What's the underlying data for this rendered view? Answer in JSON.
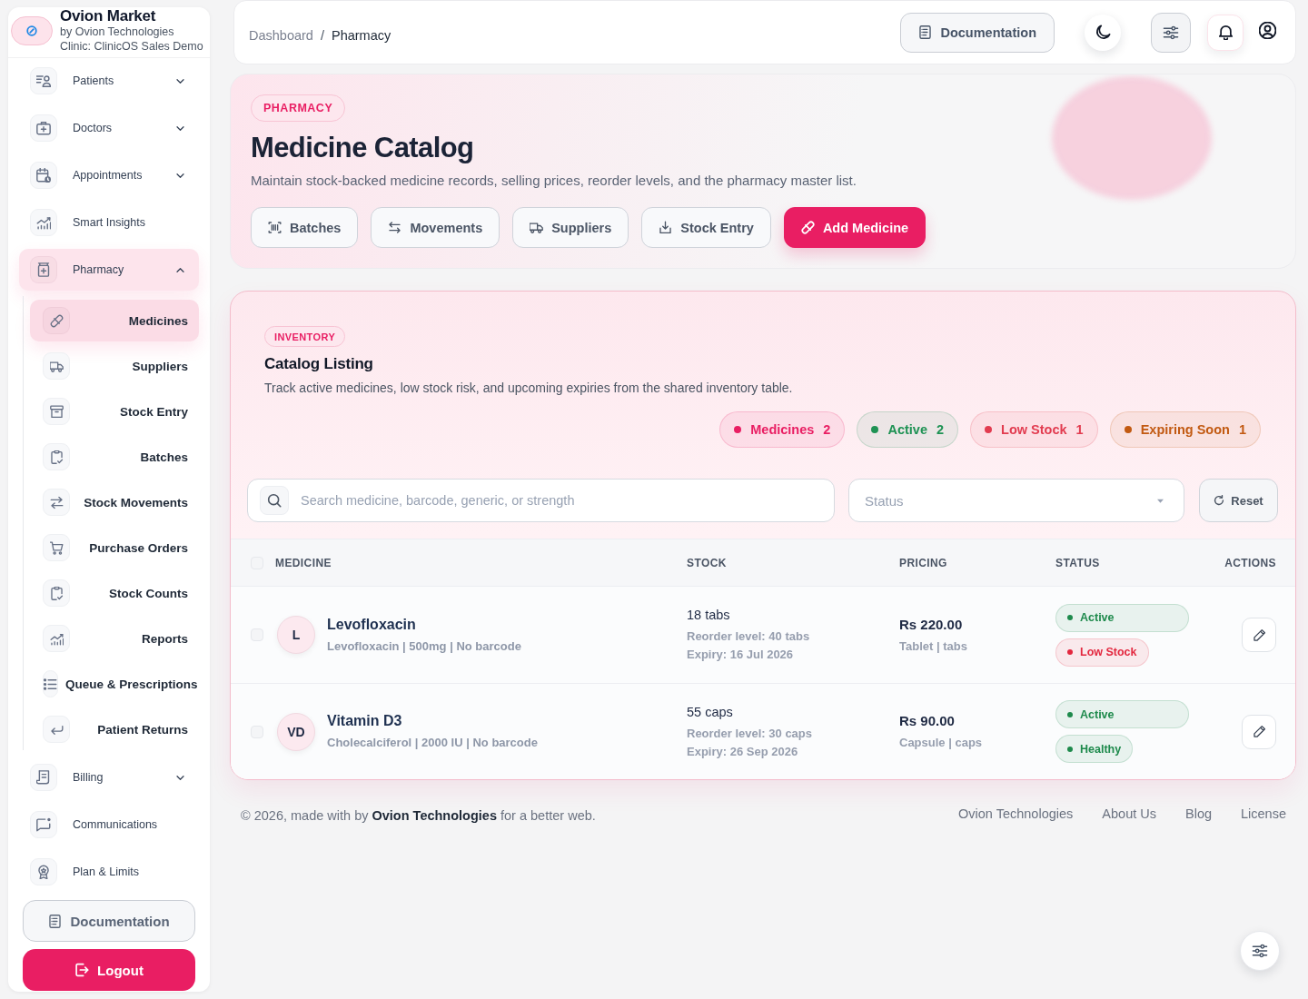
{
  "sidebar": {
    "brand": {
      "name": "Ovion Market",
      "byline": "by Ovion Technologies",
      "clinic": "Clinic: ClinicOS Sales Demo"
    },
    "nav": [
      {
        "label": "Patients",
        "kind": "group",
        "expanded": false,
        "selected": false
      },
      {
        "label": "Doctors",
        "kind": "group",
        "expanded": false,
        "selected": false
      },
      {
        "label": "Appointments",
        "kind": "group",
        "expanded": false,
        "selected": false
      },
      {
        "label": "Smart Insights",
        "kind": "link",
        "selected": false
      },
      {
        "label": "Pharmacy",
        "kind": "group",
        "expanded": true,
        "selected": true,
        "children": [
          {
            "label": "Medicines",
            "selected": true
          },
          {
            "label": "Suppliers",
            "selected": false
          },
          {
            "label": "Stock Entry",
            "selected": false
          },
          {
            "label": "Batches",
            "selected": false
          },
          {
            "label": "Stock Movements",
            "selected": false
          },
          {
            "label": "Purchase Orders",
            "selected": false
          },
          {
            "label": "Stock Counts",
            "selected": false
          },
          {
            "label": "Reports",
            "selected": false
          },
          {
            "label": "Queue & Prescriptions",
            "selected": false
          },
          {
            "label": "Patient Returns",
            "selected": false
          }
        ]
      },
      {
        "label": "Billing",
        "kind": "group",
        "expanded": false,
        "selected": false
      },
      {
        "label": "Communications",
        "kind": "link",
        "selected": false
      },
      {
        "label": "Plan & Limits",
        "kind": "link",
        "selected": false
      }
    ],
    "documentation_button": "Documentation",
    "logout_button": "Logout"
  },
  "header": {
    "breadcrumb": {
      "items": [
        "Dashboard",
        "Pharmacy"
      ],
      "separator": "/"
    },
    "documentation_button": "Documentation"
  },
  "hero": {
    "badge": "PHARMACY",
    "title": "Medicine Catalog",
    "description": "Maintain stock-backed medicine records, selling prices, reorder levels, and the pharmacy master list.",
    "actions": [
      {
        "label": "Batches",
        "kind": "outline"
      },
      {
        "label": "Movements",
        "kind": "outline"
      },
      {
        "label": "Suppliers",
        "kind": "outline"
      },
      {
        "label": "Stock Entry",
        "kind": "outline"
      },
      {
        "label": "Add Medicine",
        "kind": "primary"
      }
    ]
  },
  "catalog": {
    "badge": "INVENTORY",
    "title": "Catalog Listing",
    "description": "Track active medicines, low stock risk, and upcoming expiries from the shared inventory table.",
    "stats": [
      {
        "label": "Medicines",
        "count": "2",
        "color": "#e91e63"
      },
      {
        "label": "Active",
        "count": "2",
        "color": "#1f9254"
      },
      {
        "label": "Low Stock",
        "count": "1",
        "color": "#e23c50"
      },
      {
        "label": "Expiring Soon",
        "count": "1",
        "color": "#c25a12"
      }
    ],
    "search": {
      "placeholder": "Search medicine, barcode, generic, or strength"
    },
    "status_filter": {
      "placeholder": "Status"
    },
    "reset_button": "Reset",
    "table": {
      "all_checked": false,
      "columns": [
        "MEDICINE",
        "STOCK",
        "PRICING",
        "STATUS",
        "ACTIONS"
      ],
      "rows": [
        {
          "checked": false,
          "initials": "L",
          "name": "Levofloxacin",
          "details": "Levofloxacin | 500mg | No barcode",
          "stock": "18 tabs",
          "reorder_level": "Reorder level: 40 tabs",
          "expiry": "Expiry: 16 Jul 2026",
          "price": "Rs 220.00",
          "unit": "Tablet | tabs",
          "statuses": [
            {
              "kind": "state",
              "label": "Active",
              "color": "#1e8a4c"
            },
            {
              "kind": "stock",
              "label": "Low Stock",
              "color": "#e3283f"
            }
          ]
        },
        {
          "checked": false,
          "initials": "VD",
          "name": "Vitamin D3",
          "details": "Cholecalciferol | 2000 IU | No barcode",
          "stock": "55 caps",
          "reorder_level": "Reorder level: 30 caps",
          "expiry": "Expiry: 26 Sep 2026",
          "price": "Rs 90.00",
          "unit": "Capsule | caps",
          "statuses": [
            {
              "kind": "state",
              "label": "Active",
              "color": "#1e8a4c"
            },
            {
              "kind": "stock",
              "label": "Healthy",
              "color": "#1e8a4c"
            }
          ]
        }
      ]
    }
  },
  "footer": {
    "copyright": "© 2026, made with by **Ovion Technologies** for a better web.",
    "links": [
      "Ovion Technologies",
      "About Us",
      "Blog",
      "License"
    ]
  }
}
